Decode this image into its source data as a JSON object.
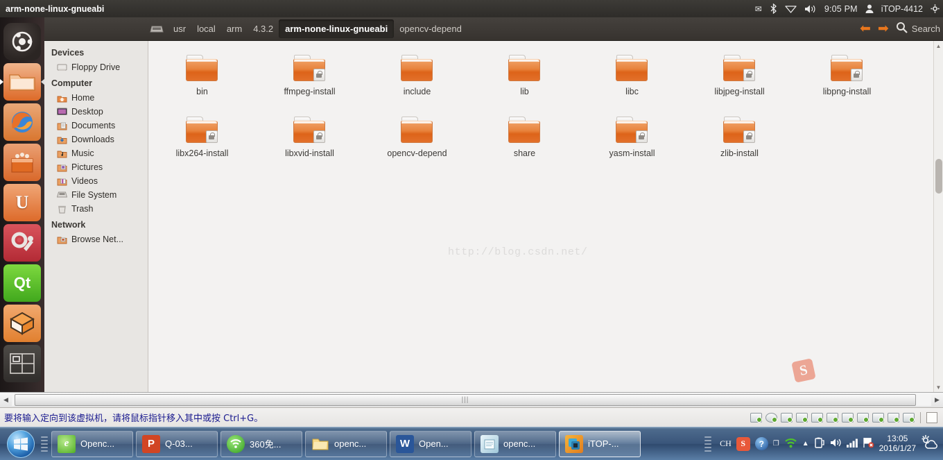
{
  "vm": {
    "title": "arm-none-linux-gnueabi",
    "status_message": "要将输入定向到该虚拟机，请将鼠标指针移入其中或按 Ctrl+G。",
    "device_icons": [
      "hard-disk-icon",
      "cd-drive-icon",
      "floppy-icon",
      "network-icon",
      "printer-icon",
      "usb-controller-icon",
      "usb-device-icon",
      "sound-icon",
      "usb-stick-icon",
      "usb-stick2-icon",
      "camera-icon"
    ],
    "note_icon": "message-log-icon",
    "hscroll": {
      "left_arrow": "◀",
      "right_arrow": "▶",
      "grip": "|||"
    }
  },
  "ubuntu_panel": {
    "indicators": [
      "mail-icon",
      "bluetooth-icon",
      "wifi-icon",
      "volume-icon"
    ],
    "clock": "9:05 PM",
    "user_icon": "user-icon",
    "username": "iTOP-4412",
    "gear_icon": "gear-icon"
  },
  "launcher": {
    "items": [
      {
        "name": "dash-home",
        "icon": "ubuntu-logo-icon",
        "glyph": "◉",
        "active": false
      },
      {
        "name": "files",
        "icon": "files-folder-icon",
        "glyph": "",
        "active": true
      },
      {
        "name": "firefox",
        "icon": "firefox-icon",
        "glyph": "",
        "active": false
      },
      {
        "name": "software-center",
        "icon": "software-center-icon",
        "glyph": "",
        "active": false
      },
      {
        "name": "ubuntu-one",
        "icon": "ubuntu-one-icon",
        "glyph": "U",
        "active": false
      },
      {
        "name": "system-settings",
        "icon": "system-settings-icon",
        "glyph": "",
        "active": false
      },
      {
        "name": "qt-creator",
        "icon": "qt-creator-icon",
        "glyph": "Qt",
        "active": false
      },
      {
        "name": "archive-manager",
        "icon": "archive-box-icon",
        "glyph": "",
        "active": false
      },
      {
        "name": "workspace-switcher",
        "icon": "workspace-switcher-icon",
        "glyph": "",
        "active": false
      }
    ]
  },
  "file_manager": {
    "breadcrumb": {
      "drive_icon": "file-system-icon",
      "items": [
        {
          "label": "usr",
          "selected": false
        },
        {
          "label": "local",
          "selected": false
        },
        {
          "label": "arm",
          "selected": false
        },
        {
          "label": "4.3.2",
          "selected": false
        },
        {
          "label": "arm-none-linux-gnueabi",
          "selected": true
        },
        {
          "label": "opencv-depend",
          "selected": false
        }
      ]
    },
    "toolbar": {
      "back_icon": "back-arrow-icon",
      "back_glyph": "⬅",
      "forward_icon": "forward-arrow-icon",
      "forward_glyph": "➡",
      "search_icon": "search-icon",
      "search_label": "Search"
    },
    "sidebar": {
      "groups": [
        {
          "heading": "Devices",
          "items": [
            {
              "label": "Floppy Drive",
              "icon": "floppy-drive-icon"
            }
          ]
        },
        {
          "heading": "Computer",
          "items": [
            {
              "label": "Home",
              "icon": "home-folder-icon"
            },
            {
              "label": "Desktop",
              "icon": "desktop-icon"
            },
            {
              "label": "Documents",
              "icon": "documents-folder-icon"
            },
            {
              "label": "Downloads",
              "icon": "downloads-folder-icon"
            },
            {
              "label": "Music",
              "icon": "music-folder-icon"
            },
            {
              "label": "Pictures",
              "icon": "pictures-folder-icon"
            },
            {
              "label": "Videos",
              "icon": "videos-folder-icon"
            },
            {
              "label": "File System",
              "icon": "file-system-icon"
            },
            {
              "label": "Trash",
              "icon": "trash-icon"
            }
          ]
        },
        {
          "heading": "Network",
          "items": [
            {
              "label": "Browse Net...",
              "icon": "network-folder-icon"
            }
          ]
        }
      ]
    },
    "files": {
      "row1": [
        {
          "name": "bin",
          "locked": false
        },
        {
          "name": "ffmpeg-install",
          "locked": true
        },
        {
          "name": "include",
          "locked": false
        },
        {
          "name": "lib",
          "locked": false
        },
        {
          "name": "libc",
          "locked": false
        },
        {
          "name": "libjpeg-install",
          "locked": true
        },
        {
          "name": "libpng-install",
          "locked": true
        }
      ],
      "row2": [
        {
          "name": "libx264-install",
          "locked": true
        },
        {
          "name": "libxvid-install",
          "locked": true
        },
        {
          "name": "opencv-depend",
          "locked": false
        },
        {
          "name": "share",
          "locked": false
        },
        {
          "name": "yasm-install",
          "locked": true
        },
        {
          "name": "zlib-install",
          "locked": true
        }
      ]
    },
    "watermark": "http://blog.csdn.net/",
    "sogou_watermark": "S"
  },
  "taskbar": {
    "start_icon": "windows-start-orb-icon",
    "items": [
      {
        "label": "Openc...",
        "icon": "ie-browser-icon",
        "glyph": "e",
        "color": "#5bbd2a",
        "active": false
      },
      {
        "label": "Q-03...",
        "icon": "powerpoint-icon",
        "glyph": "P",
        "color": "#d14524",
        "active": false
      },
      {
        "label": "360免...",
        "icon": "360-wifi-icon",
        "glyph": "",
        "color": "#3fae2a",
        "active": false
      },
      {
        "label": "openc...",
        "icon": "folder-explorer-icon",
        "glyph": "",
        "color": "#f3ce6a",
        "active": false
      },
      {
        "label": "Open...",
        "icon": "word-icon",
        "glyph": "W",
        "color": "#2a5699",
        "active": false
      },
      {
        "label": "openc...",
        "icon": "notepad-icon",
        "glyph": "",
        "color": "#cfe6f0",
        "active": false
      },
      {
        "label": "iTOP-...",
        "icon": "vmware-icon",
        "glyph": "",
        "color": "#f2a229",
        "active": true
      }
    ],
    "tray": {
      "ime": "CH",
      "icons": [
        "sogou-icon",
        "help-icon",
        "restore-icon",
        "wifi-360-icon",
        "show-hidden-icon",
        "battery-icon",
        "volume-icon",
        "signal-icon",
        "flag-error-icon"
      ],
      "sogou_glyph": "S",
      "help_glyph": "?",
      "time": "13:05",
      "date": "2016/1/27",
      "weather_icon": "weather-sun-cloud-icon"
    }
  }
}
